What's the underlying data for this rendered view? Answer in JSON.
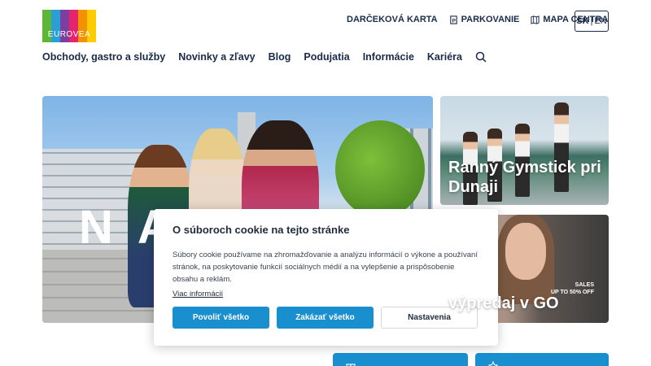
{
  "brand": {
    "logo_text": "EUROVEA",
    "logo_colors": [
      "#5fb536",
      "#2a9fd6",
      "#7b3fa0",
      "#e6246e",
      "#f39200",
      "#ffcc00"
    ],
    "accent_color": "#1a8fd0",
    "text_color": "#1a2b4a"
  },
  "header": {
    "top_links": [
      {
        "label": "DARČEKOVÁ KARTA",
        "icon": null
      },
      {
        "label": "PARKOVANIE",
        "icon": "parking-icon"
      },
      {
        "label": "MAPA CENTRA",
        "icon": "map-icon"
      }
    ],
    "language": {
      "active": "SK",
      "separator": "|",
      "other": "EN"
    }
  },
  "main_nav": {
    "items": [
      "Obchody, gastro a služby",
      "Novinky a zľavy",
      "Blog",
      "Podujatia",
      "Informácie",
      "Kariéra"
    ],
    "search_icon": "search-icon"
  },
  "hero": {
    "overlay_text": "N A"
  },
  "cards": [
    {
      "title": "Ranný Gymstick pri Dunaji"
    },
    {
      "title": "výpredaj v GO",
      "promo": [
        "SALES",
        "UP TO 50% OFF"
      ]
    }
  ],
  "cookie_banner": {
    "title": "O súboroch cookie na tejto stránke",
    "body": "Súbory cookie používame na zhromažďovanie a analýzu informácií o výkone a používaní stránok, na poskytovanie funkcií sociálnych médií a na vylepšenie a prispôsobenie obsahu a reklám.",
    "more_link": "Viac informácií",
    "buttons": {
      "allow_all": "Povoliť všetko",
      "deny_all": "Zakázať všetko",
      "settings": "Nastavenia"
    }
  }
}
